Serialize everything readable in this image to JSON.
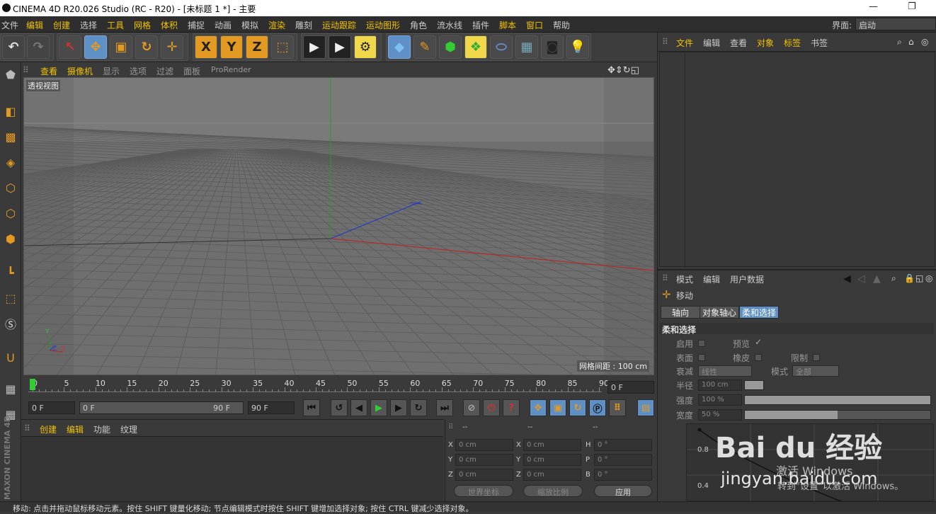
{
  "window": {
    "title": "CINEMA 4D R20.026 Studio (RC - R20) - [未标题 1 *] - 主要",
    "restore_icon": "restore-icon",
    "minimize": "—"
  },
  "menu": {
    "items": [
      "文件",
      "编辑",
      "创建",
      "选择",
      "工具",
      "网格",
      "体积",
      "捕捉",
      "动画",
      "模拟",
      "渲染",
      "雕刻",
      "运动跟踪",
      "运动图形",
      "角色",
      "流水线",
      "插件",
      "脚本",
      "窗口",
      "帮助"
    ],
    "layout_label": "界面:",
    "layout_value": "启动"
  },
  "toolbar": {
    "undo": "undo-icon",
    "redo": "redo-icon",
    "x_label": "X",
    "y_label": "Y",
    "z_label": "Z"
  },
  "viewport": {
    "menu": [
      "查看",
      "摄像机",
      "显示",
      "选项",
      "过滤",
      "面板",
      "ProRender"
    ],
    "label": "透视视图",
    "grid_spacing": "网格间距 : 100 cm",
    "axis_y": "Y",
    "axis_x": "X",
    "axis_z": "Z",
    "colors": {
      "bg": "#6f6f6f",
      "sky": "#7a7a7a",
      "x_axis": "#c81e1e",
      "y_axis": "#23a023",
      "z_axis": "#2337c8"
    }
  },
  "timeline": {
    "ticks": [
      "0",
      "5",
      "10",
      "15",
      "20",
      "25",
      "30",
      "35",
      "40",
      "45",
      "50",
      "55",
      "60",
      "65",
      "70",
      "75",
      "80",
      "85",
      "90"
    ],
    "current_frame": "0 F"
  },
  "frame_bar": {
    "start": "0 F",
    "range_start": "0 F",
    "range_end": "90 F",
    "end": "90 F"
  },
  "material_manager": {
    "menu": [
      "创建",
      "编辑",
      "功能",
      "纹理"
    ]
  },
  "coordinates": {
    "header": [
      "--",
      "--",
      "--"
    ],
    "rows": [
      {
        "a": "X",
        "av": "0 cm",
        "b": "X",
        "bv": "0 cm",
        "c": "H",
        "cv": "0 °"
      },
      {
        "a": "Y",
        "av": "0 cm",
        "b": "Y",
        "bv": "0 cm",
        "c": "P",
        "cv": "0 °"
      },
      {
        "a": "Z",
        "av": "0 cm",
        "b": "Z",
        "bv": "0 cm",
        "c": "B",
        "cv": "0 °"
      }
    ],
    "world": "世界坐标",
    "scale": "缩放比例",
    "apply": "应用"
  },
  "object_manager": {
    "menu": [
      "文件",
      "编辑",
      "查看",
      "对象",
      "标签",
      "书签"
    ]
  },
  "attributes": {
    "menu": [
      "模式",
      "编辑",
      "用户数据"
    ],
    "tool_name": "移动",
    "tabs": [
      "轴向",
      "对象轴心",
      "柔和选择"
    ],
    "section": "柔和选择",
    "enable": "启用",
    "preview": "预览",
    "preview_check": "✓",
    "surface": "表面",
    "rubber": "橡皮",
    "restrict": "限制",
    "falloff": "衰减",
    "falloff_value": "线性",
    "mode": "模式",
    "mode_value": "全部",
    "radius": "半径",
    "radius_value": "100 cm",
    "strength": "强度",
    "strength_value": "100 %",
    "strength_level": 1.0,
    "width": "宽度",
    "width_value": "50 %",
    "width_level": 0.5,
    "graph_y1": "0.8",
    "graph_y2": "0.4"
  },
  "status": "移动: 点击并拖动鼠标移动元素。按住 SHIFT 键量化移动; 节点编辑模式时按住 SHIFT 键增加选择对象; 按住 CTRL 键减少选择对象。",
  "brand": "MAXON CINEMA 4D",
  "watermark": {
    "logo": "Bai du 经验",
    "url": "jingyan.baidu.com",
    "activate": "激活 Windows",
    "activate_sub": "转到\"设置\"以激活 Windows。"
  }
}
